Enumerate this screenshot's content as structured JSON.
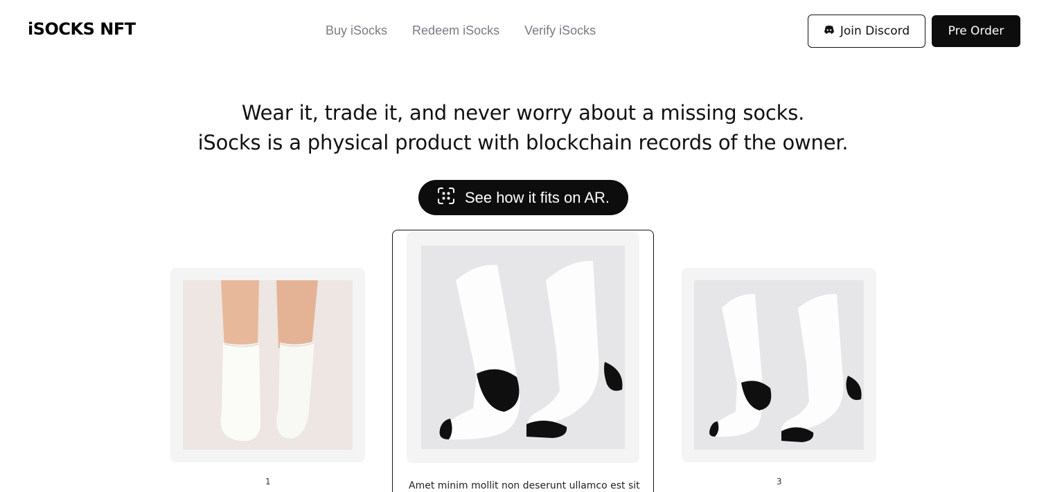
{
  "header": {
    "logo": "iSOCKS NFT",
    "nav": [
      "Buy iSocks",
      "Redeem iSocks",
      "Verify iSocks"
    ],
    "discord_label": "Join Discord",
    "preorder_label": "Pre Order"
  },
  "hero": {
    "line1": "Wear it, trade it, and never worry about a missing socks.",
    "line2": "iSocks is a physical product with blockchain records of the owner.",
    "ar_button": "See how it fits on AR."
  },
  "products": [
    {
      "caption": "1"
    },
    {
      "description": "Amet minim mollit non deserunt ullamco est sit"
    },
    {
      "caption": "3"
    }
  ],
  "colors": {
    "accent": "#0d0d0d",
    "nav_text": "#7a7a85",
    "card_bg": "#f4f4f4"
  }
}
